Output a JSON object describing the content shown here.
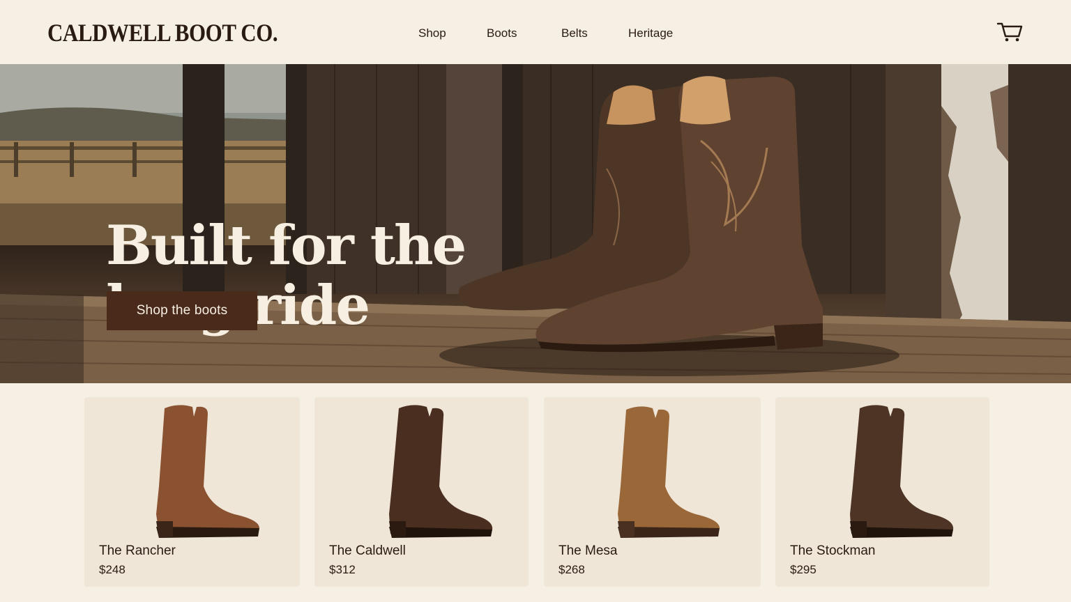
{
  "brand": {
    "name": "CALDWELL BOOT CO."
  },
  "nav": {
    "items": [
      {
        "label": "Shop"
      },
      {
        "label": "Boots"
      },
      {
        "label": "Belts"
      },
      {
        "label": "Heritage"
      }
    ],
    "cart_icon": "cart-icon"
  },
  "hero": {
    "title_line_1": "Built for the",
    "title_line_2": "long ride",
    "cta_label": "Shop the boots",
    "image": "cowboy-boots-on-porch"
  },
  "products": [
    {
      "name": "The Rancher",
      "price": "$248",
      "color": "#8a5230"
    },
    {
      "name": "The Caldwell",
      "price": "$312",
      "color": "#4a2e1f"
    },
    {
      "name": "The Mesa",
      "price": "$268",
      "color": "#9a6838"
    },
    {
      "name": "The Stockman",
      "price": "$295",
      "color": "#4d3424"
    }
  ],
  "colors": {
    "background": "#f6f0e4",
    "card": "#efe6d8",
    "cta": "#4a2a1a",
    "text": "#2a1b12"
  }
}
